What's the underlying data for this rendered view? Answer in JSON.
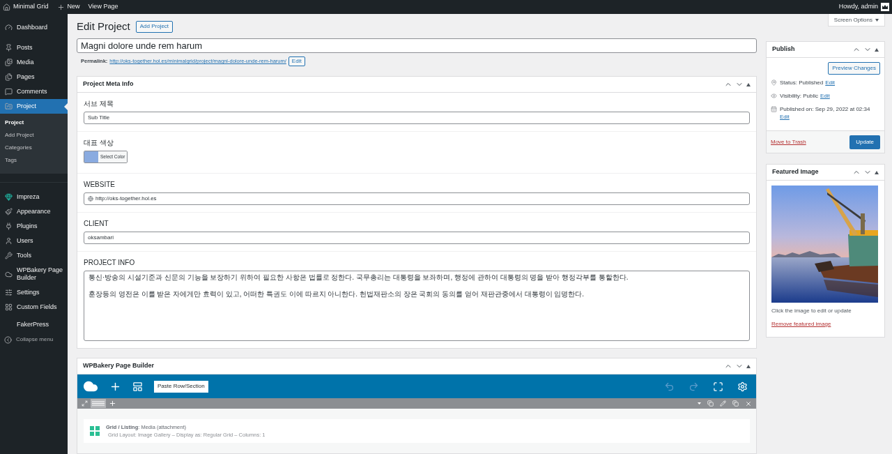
{
  "admin_bar": {
    "site": "Minimal Grid",
    "new": "New",
    "view": "View Page",
    "greeting": "Howdy, admin"
  },
  "sidebar": {
    "groups": [
      {
        "items": [
          {
            "label": "Dashboard",
            "selected": false
          }
        ]
      },
      {
        "items": [
          {
            "label": "Posts",
            "selected": false
          },
          {
            "label": "Media",
            "selected": false
          },
          {
            "label": "Pages",
            "selected": false
          },
          {
            "label": "Comments",
            "selected": false
          },
          {
            "label": "Project",
            "selected": true,
            "submenu": [
              {
                "label": "Project",
                "selected": true
              },
              {
                "label": "Add Project",
                "selected": false
              },
              {
                "label": "Categories",
                "selected": false
              },
              {
                "label": "Tags",
                "selected": false
              }
            ]
          }
        ]
      },
      {
        "items": [
          {
            "label": "Impreza",
            "selected": false
          },
          {
            "label": "Appearance",
            "selected": false
          },
          {
            "label": "Plugins",
            "selected": false
          },
          {
            "label": "Users",
            "selected": false
          },
          {
            "label": "Tools",
            "selected": false
          },
          {
            "label": "WPBakery Page Builder",
            "selected": false
          },
          {
            "label": "Settings",
            "selected": false
          },
          {
            "label": "Custom Fields",
            "selected": false
          }
        ]
      },
      {
        "items": [
          {
            "label": "FakerPress",
            "selected": false
          }
        ]
      }
    ],
    "collapse": "Collapse menu"
  },
  "page": {
    "title": "Edit Project",
    "add_button": "Add Project",
    "screen_options": "Screen Options"
  },
  "post_title": {
    "value": "Magni dolore unde rem harum"
  },
  "permalink": {
    "label": "Permalink:",
    "url": "http://oks-together.hol.es/minimalgrid/project/magni-dolore-unde-rem-harum/",
    "edit": "Edit"
  },
  "meta_box": {
    "title": "Project Meta Info",
    "fields": [
      {
        "kind": "text",
        "label": "서브 제목",
        "value": "Sub Title"
      },
      {
        "kind": "color",
        "label": "대표 색상",
        "color": "#8aabe0",
        "button": "Select Color"
      },
      {
        "kind": "url",
        "label": "WEBSITE",
        "value": "http://oks-together.hol.es"
      },
      {
        "kind": "text",
        "label": "CLIENT",
        "value": "oksambari"
      },
      {
        "kind": "textarea",
        "label": "PROJECT INFO",
        "paragraphs": [
          "통신·방송의 시설기준과 신문의 기능을 보장하기 위하여 필요한 사항은 법률로 정한다. 국무총리는 대통령을 보좌하며, 행정에 관하여 대통령의 명을 받아 행정각부를 통할한다.",
          "훈장등의 영전은 이를 받은 자에게만 효력이 있고, 어떠한 특권도 이에 따르지 아니한다. 헌법재판소의 장은 국회의 동의를 얻어 재판관중에서 대통령이 임명한다."
        ]
      }
    ]
  },
  "page_builder": {
    "title": "WPBakery Page Builder",
    "paste_button": "Paste Row/Section",
    "element": {
      "name": "**Grid / Listing**: Media (attachment)",
      "details": "Grid Layout: Image Gallery – Display as: Regular Grid – Columns: 1"
    }
  },
  "publish": {
    "title": "Publish",
    "preview": "Preview Changes",
    "rows": [
      {
        "text": "Status: Published",
        "link": "Edit"
      },
      {
        "text": "Visibility: Public",
        "link": "Edit"
      },
      {
        "text": "Published on: Sep 29, 2022 at 02:34",
        "link": "Edit"
      }
    ],
    "trash": "Move to Trash",
    "update": "Update"
  },
  "featured_image": {
    "title": "Featured Image",
    "caption": "Click the image to edit or update",
    "remove": "Remove featured image"
  }
}
